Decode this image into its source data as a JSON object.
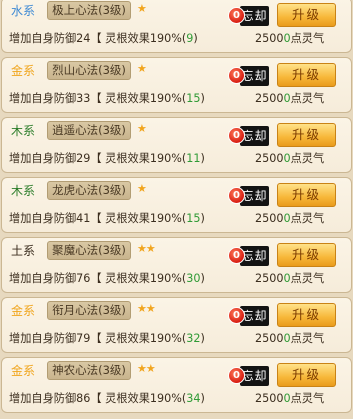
{
  "colors": {
    "water": "#3e8ad4",
    "gold": "#f0a51c",
    "wood": "#2c7d2a",
    "earth": "#3b2d1e",
    "green_value": "#2f9a35",
    "upgrade_button": "#f7b739",
    "forget_label": "#141414"
  },
  "labels": {
    "forget_badge": "0",
    "forget": "忘却",
    "upgrade": "升级",
    "effect_prefix": "增加自身防御",
    "effect_middle": "【 灵根效果190%(",
    "effect_suffix": ")",
    "cost_prefix": "2500",
    "cost_zero": "0",
    "cost_suffix": "点灵气"
  },
  "skills": [
    {
      "element": "水系",
      "element_color": "water",
      "name": "极上心法(3级)",
      "stars": "★",
      "defense": "24",
      "level": "9"
    },
    {
      "element": "金系",
      "element_color": "gold",
      "name": "烈山心法(3级)",
      "stars": "★",
      "defense": "33",
      "level": "15"
    },
    {
      "element": "木系",
      "element_color": "wood",
      "name": "逍遥心法(3级)",
      "stars": "★",
      "defense": "29",
      "level": "11"
    },
    {
      "element": "木系",
      "element_color": "wood",
      "name": "龙虎心法(3级)",
      "stars": "★",
      "defense": "41",
      "level": "15"
    },
    {
      "element": "土系",
      "element_color": "earth",
      "name": "聚魔心法(3级)",
      "stars": "★★",
      "defense": "76",
      "level": "30"
    },
    {
      "element": "金系",
      "element_color": "gold",
      "name": "衔月心法(3级)",
      "stars": "★★",
      "defense": "79",
      "level": "32"
    },
    {
      "element": "金系",
      "element_color": "gold",
      "name": "神农心法(3级)",
      "stars": "★★",
      "defense": "86",
      "level": "34"
    }
  ]
}
